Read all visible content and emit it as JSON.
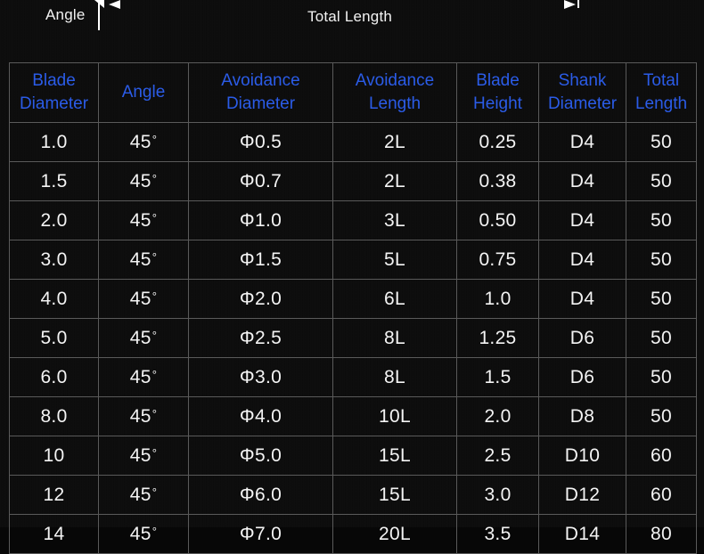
{
  "diagram": {
    "labels": {
      "angle": "Angle",
      "total_length": "Total Length"
    },
    "markers": [
      "arrow-left",
      "arrow-right",
      "dimension-tick"
    ]
  },
  "table": {
    "headers": [
      "Blade Diameter",
      "Angle",
      "Avoidance Diameter",
      "Avoidance Length",
      "Blade Height",
      "Shank Diameter",
      "Total Length"
    ],
    "header_lines": [
      [
        "Blade",
        "Diameter"
      ],
      [
        "Angle",
        ""
      ],
      [
        "Avoidance",
        "Diameter"
      ],
      [
        "Avoidance",
        "Length"
      ],
      [
        "Blade",
        "Height"
      ],
      [
        "Shank",
        "Diameter"
      ],
      [
        "Total",
        "Length"
      ]
    ],
    "rows": [
      {
        "blade_diameter": "1.0",
        "angle": "45",
        "avoidance_diameter": "Φ0.5",
        "avoidance_length": "2L",
        "blade_height": "0.25",
        "shank_diameter": "D4",
        "total_length": "50"
      },
      {
        "blade_diameter": "1.5",
        "angle": "45",
        "avoidance_diameter": "Φ0.7",
        "avoidance_length": "2L",
        "blade_height": "0.38",
        "shank_diameter": "D4",
        "total_length": "50"
      },
      {
        "blade_diameter": "2.0",
        "angle": "45",
        "avoidance_diameter": "Φ1.0",
        "avoidance_length": "3L",
        "blade_height": "0.50",
        "shank_diameter": "D4",
        "total_length": "50"
      },
      {
        "blade_diameter": "3.0",
        "angle": "45",
        "avoidance_diameter": "Φ1.5",
        "avoidance_length": "5L",
        "blade_height": "0.75",
        "shank_diameter": "D4",
        "total_length": "50"
      },
      {
        "blade_diameter": "4.0",
        "angle": "45",
        "avoidance_diameter": "Φ2.0",
        "avoidance_length": "6L",
        "blade_height": "1.0",
        "shank_diameter": "D4",
        "total_length": "50"
      },
      {
        "blade_diameter": "5.0",
        "angle": "45",
        "avoidance_diameter": "Φ2.5",
        "avoidance_length": "8L",
        "blade_height": "1.25",
        "shank_diameter": "D6",
        "total_length": "50"
      },
      {
        "blade_diameter": "6.0",
        "angle": "45",
        "avoidance_diameter": "Φ3.0",
        "avoidance_length": "8L",
        "blade_height": "1.5",
        "shank_diameter": "D6",
        "total_length": "50"
      },
      {
        "blade_diameter": "8.0",
        "angle": "45",
        "avoidance_diameter": "Φ4.0",
        "avoidance_length": "10L",
        "blade_height": "2.0",
        "shank_diameter": "D8",
        "total_length": "50"
      },
      {
        "blade_diameter": "10",
        "angle": "45",
        "avoidance_diameter": "Φ5.0",
        "avoidance_length": "15L",
        "blade_height": "2.5",
        "shank_diameter": "D10",
        "total_length": "60"
      },
      {
        "blade_diameter": "12",
        "angle": "45",
        "avoidance_diameter": "Φ6.0",
        "avoidance_length": "15L",
        "blade_height": "3.0",
        "shank_diameter": "D12",
        "total_length": "60"
      },
      {
        "blade_diameter": "14",
        "angle": "45",
        "avoidance_diameter": "Φ7.0",
        "avoidance_length": "20L",
        "blade_height": "3.5",
        "shank_diameter": "D14",
        "total_length": "80"
      }
    ],
    "degree_symbol": "°"
  },
  "colors": {
    "background": "#0b0b0b",
    "header_text": "#2b5ce8",
    "body_text": "#f4f4f4",
    "grid_line": "#5a5a5a",
    "diagram_line": "#ffffff"
  }
}
